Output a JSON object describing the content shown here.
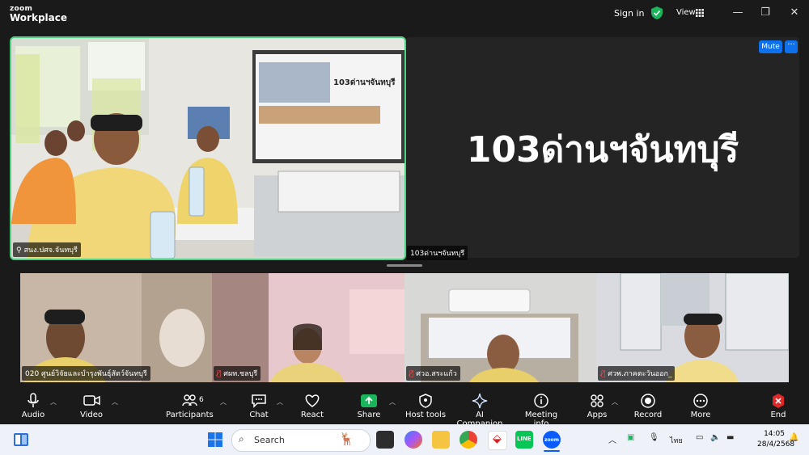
{
  "titlebar": {
    "logo_top": "zoom",
    "logo_bottom": "Workplace",
    "sign_in": "Sign in",
    "view": "View",
    "minimize": "—",
    "restore": "❐",
    "close": "✕"
  },
  "stage": {
    "active_speaker": {
      "name": "สนง.ปศจ.จันทบุรี",
      "border_color": "#4bd17f"
    },
    "big_tile": {
      "display_name": "103ด่านฯจันทบุรี",
      "name_tag": "103ด่านฯจันทบุรี",
      "mute_label": "Mute",
      "more_label": "···"
    },
    "projector_text": "103ด่านฯจันทบุรี"
  },
  "gallery": [
    {
      "name": "020 ศูนย์วิจัยและบำรุงพันธุ์สัตว์จันทบุรี",
      "muted": false
    },
    {
      "name": "ศผท.ชลบุรี",
      "muted": true
    },
    {
      "name": "ศวอ.สระแก้ว",
      "muted": true
    },
    {
      "name": "ศวพ.ภาคตะวันออก_",
      "muted": true
    }
  ],
  "toolbar": {
    "audio": "Audio",
    "video": "Video",
    "participants": "Participants",
    "participants_count": "6",
    "chat": "Chat",
    "react": "React",
    "share": "Share",
    "host_tools": "Host tools",
    "ai_companion": "AI Companion",
    "meeting_info": "Meeting info",
    "apps": "Apps",
    "record": "Record",
    "more": "More",
    "end": "End",
    "share_color": "#1bb55c",
    "end_color": "#e02828"
  },
  "taskbar": {
    "search_placeholder": "Search",
    "language": "ไทย",
    "time": "14:05",
    "date": "28/4/2568"
  }
}
